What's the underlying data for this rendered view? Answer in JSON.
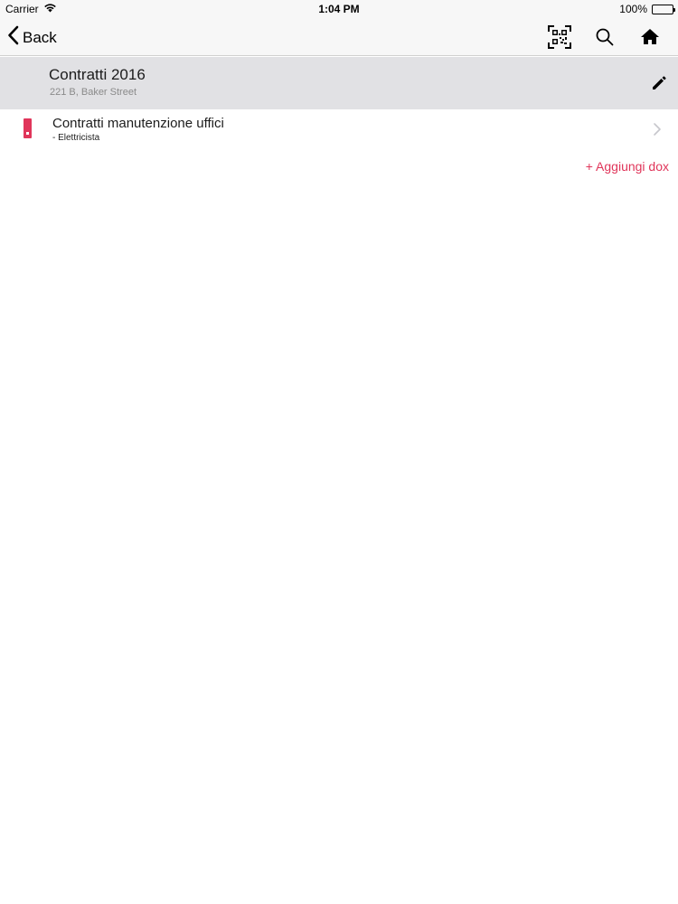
{
  "status_bar": {
    "carrier": "Carrier",
    "time": "1:04 PM",
    "battery": "100%",
    "battery_level": 1.0
  },
  "nav": {
    "back_label": "Back",
    "icons": [
      "qr-code-icon",
      "search-icon",
      "home-icon"
    ]
  },
  "header": {
    "title": "Contratti 2016",
    "subtitle": "221 B, Baker Street"
  },
  "items": [
    {
      "title": "Contratti manutenzione uffici",
      "subtitle": "- Elettricista",
      "icon": "alert-icon"
    }
  ],
  "actions": {
    "add_label": "+ Aggiungi dox"
  },
  "colors": {
    "accent": "#e0355a",
    "header_bg": "#e1e1e4",
    "nav_bg": "#f7f7f7"
  }
}
